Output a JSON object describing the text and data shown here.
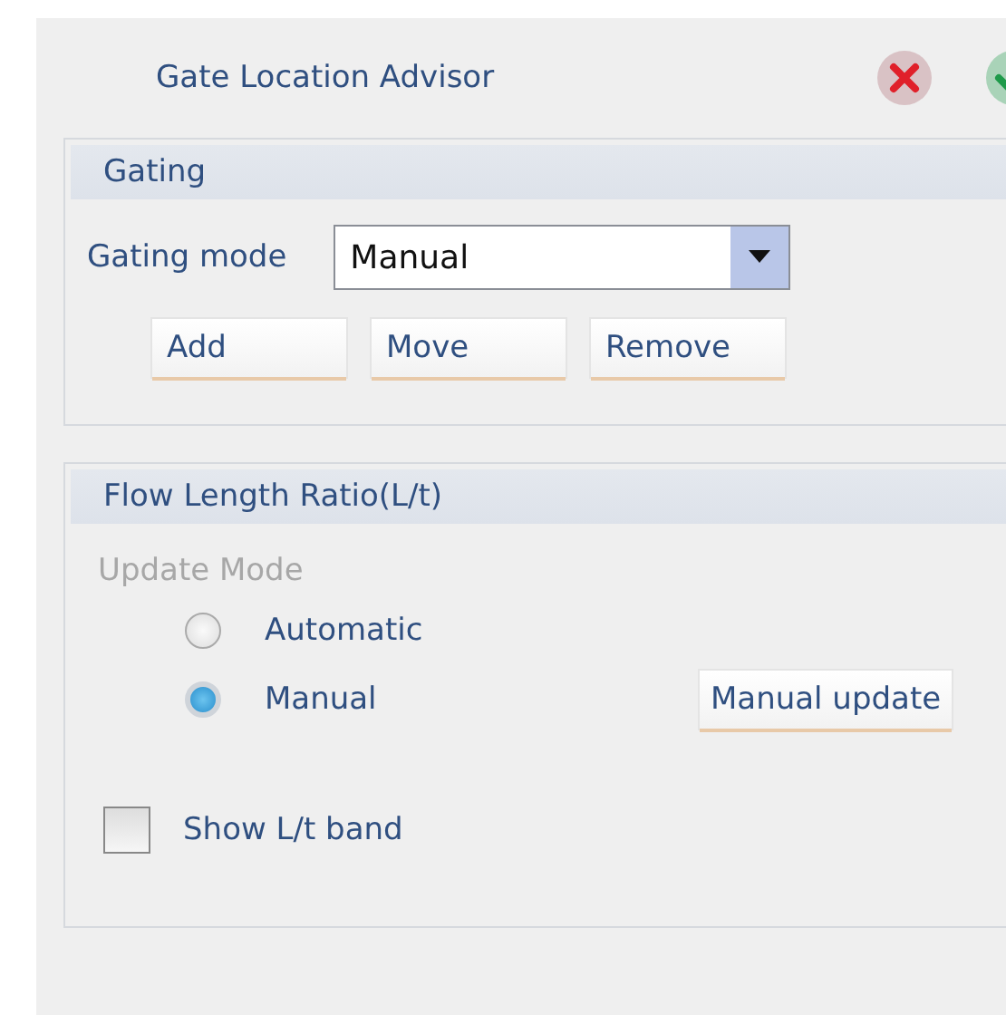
{
  "title": "Gate Location Advisor",
  "header_buttons": [
    {
      "kind": "cancel"
    },
    {
      "kind": "confirm"
    }
  ],
  "gating": {
    "header": "Gating",
    "mode_label": "Gating mode",
    "mode_value": "Manual",
    "buttons": [
      "Add",
      "Move",
      "Remove"
    ]
  },
  "flow": {
    "header": "Flow Length Ratio(L/t)",
    "update_mode": {
      "label": "Update Mode",
      "disabled": true
    },
    "options": [
      {
        "label": "Automatic",
        "selected": false
      },
      {
        "label": "Manual",
        "selected": true
      }
    ],
    "manual_update_button": "Manual update",
    "show_band": {
      "label": "Show L/t band",
      "checked": false
    }
  }
}
